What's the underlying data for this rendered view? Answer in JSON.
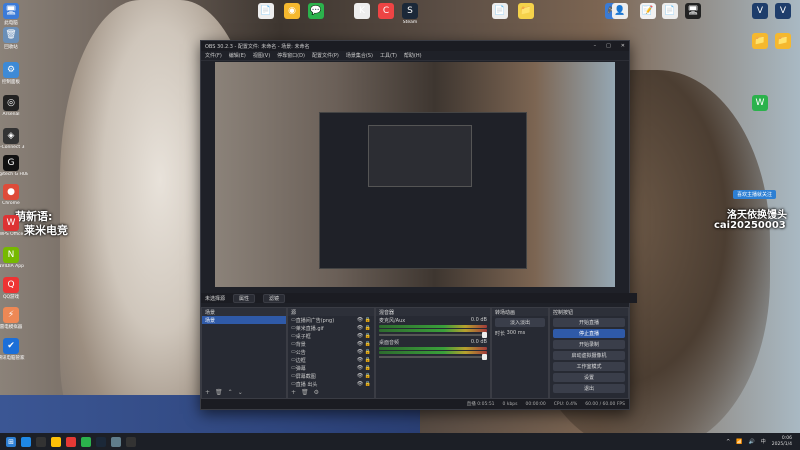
{
  "desktop": {
    "left_icons": [
      {
        "label": "此电脑",
        "color": "#3b7bd8",
        "glyph": "🖥"
      },
      {
        "label": "回收站",
        "color": "#6a8fb8",
        "glyph": "🗑"
      },
      {
        "label": "控制面板",
        "color": "#3d8ad6",
        "glyph": "⚙"
      },
      {
        "label": "Arsenal",
        "color": "#222",
        "glyph": "◎"
      },
      {
        "label": "L-Connect 3",
        "color": "#333",
        "glyph": "◈"
      },
      {
        "label": "Logitech G HUB",
        "color": "#111",
        "glyph": "G"
      },
      {
        "label": "Chrome",
        "color": "#de4b39",
        "glyph": "●"
      },
      {
        "label": "WPS Office",
        "color": "#d33",
        "glyph": "W"
      },
      {
        "label": "NVIDIA App",
        "color": "#76b900",
        "glyph": "N"
      },
      {
        "label": "QQ游戏",
        "color": "#e33",
        "glyph": "Q"
      },
      {
        "label": "雷电模拟器",
        "color": "#e85",
        "glyph": "⚡"
      },
      {
        "label": "腾讯电脑管家",
        "color": "#1c6fd8",
        "glyph": "✔"
      }
    ],
    "top_icons": [
      {
        "label": "",
        "color": "#eee",
        "glyph": "📄"
      },
      {
        "label": "",
        "color": "#f5b82e",
        "glyph": "◉"
      },
      {
        "label": "",
        "color": "#2bb24c",
        "glyph": "💬"
      },
      {
        "label": "",
        "color": "#eee",
        "glyph": "K"
      },
      {
        "label": "",
        "color": "#e44",
        "glyph": "C"
      },
      {
        "label": "Steam",
        "color": "#1b2838",
        "glyph": "S"
      }
    ],
    "right_icons": [
      {
        "label": "",
        "color": "#eee",
        "glyph": "📄"
      },
      {
        "label": "",
        "color": "#f5d24a",
        "glyph": "📁"
      },
      {
        "label": "",
        "color": "#3a7bd5",
        "glyph": "🎮"
      },
      {
        "label": "",
        "color": "#eee",
        "glyph": "👤"
      },
      {
        "label": "",
        "color": "#f2f2f2",
        "glyph": "📝"
      },
      {
        "label": "",
        "color": "#eee",
        "glyph": "📄"
      },
      {
        "label": "",
        "color": "#222",
        "glyph": "🖥"
      },
      {
        "label": "",
        "color": "#1e3d6b",
        "glyph": "V"
      },
      {
        "label": "",
        "color": "#1e3d6b",
        "glyph": "V"
      },
      {
        "label": "",
        "color": "#f5b82e",
        "glyph": "📁"
      },
      {
        "label": "",
        "color": "#f5b82e",
        "glyph": "📁"
      },
      {
        "label": "",
        "color": "#2bb24c",
        "glyph": "W"
      }
    ],
    "overlay_left": {
      "line1": "萌新语:",
      "line2": "莱米电竞"
    },
    "overlay_right": {
      "badge": "喜欢主播就关注",
      "line1": "洛天依换馒头",
      "line2": "cai20250003"
    }
  },
  "obs": {
    "title": "OBS 30.2.3 - 配置文件: 未命名 - 场景: 未命名",
    "menu": [
      "文件(F)",
      "编辑(E)",
      "视图(V)",
      "停靠窗口(D)",
      "配置文件(P)",
      "场景集合(S)",
      "工具(T)",
      "帮助(H)"
    ],
    "scene_bar": {
      "label": "未选择源",
      "props": "属性",
      "filters": "滤镜"
    },
    "docks": {
      "scenes": {
        "title": "场景",
        "items": [
          "场景"
        ]
      },
      "sources": {
        "title": "源",
        "items": [
          "直播间广告(png)",
          "莱米直播.gif",
          "桌子框",
          "背景",
          "公告",
          "边框",
          "弹幕",
          "屏幕截图",
          "直播 出头"
        ]
      },
      "mixer": {
        "title": "混音器",
        "tracks": [
          {
            "name": "麦克风/Aux",
            "db": "0.0 dB"
          },
          {
            "name": "桌面音频",
            "db": "0.0 dB"
          }
        ]
      },
      "transitions": {
        "title": "转场动画",
        "type": "淡入淡出",
        "duration_label": "时长",
        "duration": "300 ms"
      },
      "controls": {
        "title": "控制按钮",
        "buttons": [
          "开始直播",
          "停止直播",
          "开始录制",
          "启动虚拟摄像机",
          "工作室模式",
          "设置",
          "退出"
        ]
      }
    },
    "status": {
      "streaming": "直播 0:05:51",
      "dropped": "0 kbps",
      "rec": "00:00:00",
      "cpu": "CPU: 0.4%",
      "fps": "60.00 / 60.00 FPS"
    }
  },
  "taskbar": {
    "time": "0:06",
    "date": "2025/1/4",
    "lang": "中",
    "app_colors": [
      "#1e88e5",
      "#333",
      "#ffc107",
      "#e53935",
      "#2bb24c",
      "#1b2838",
      "#607d8b",
      "#333"
    ]
  }
}
